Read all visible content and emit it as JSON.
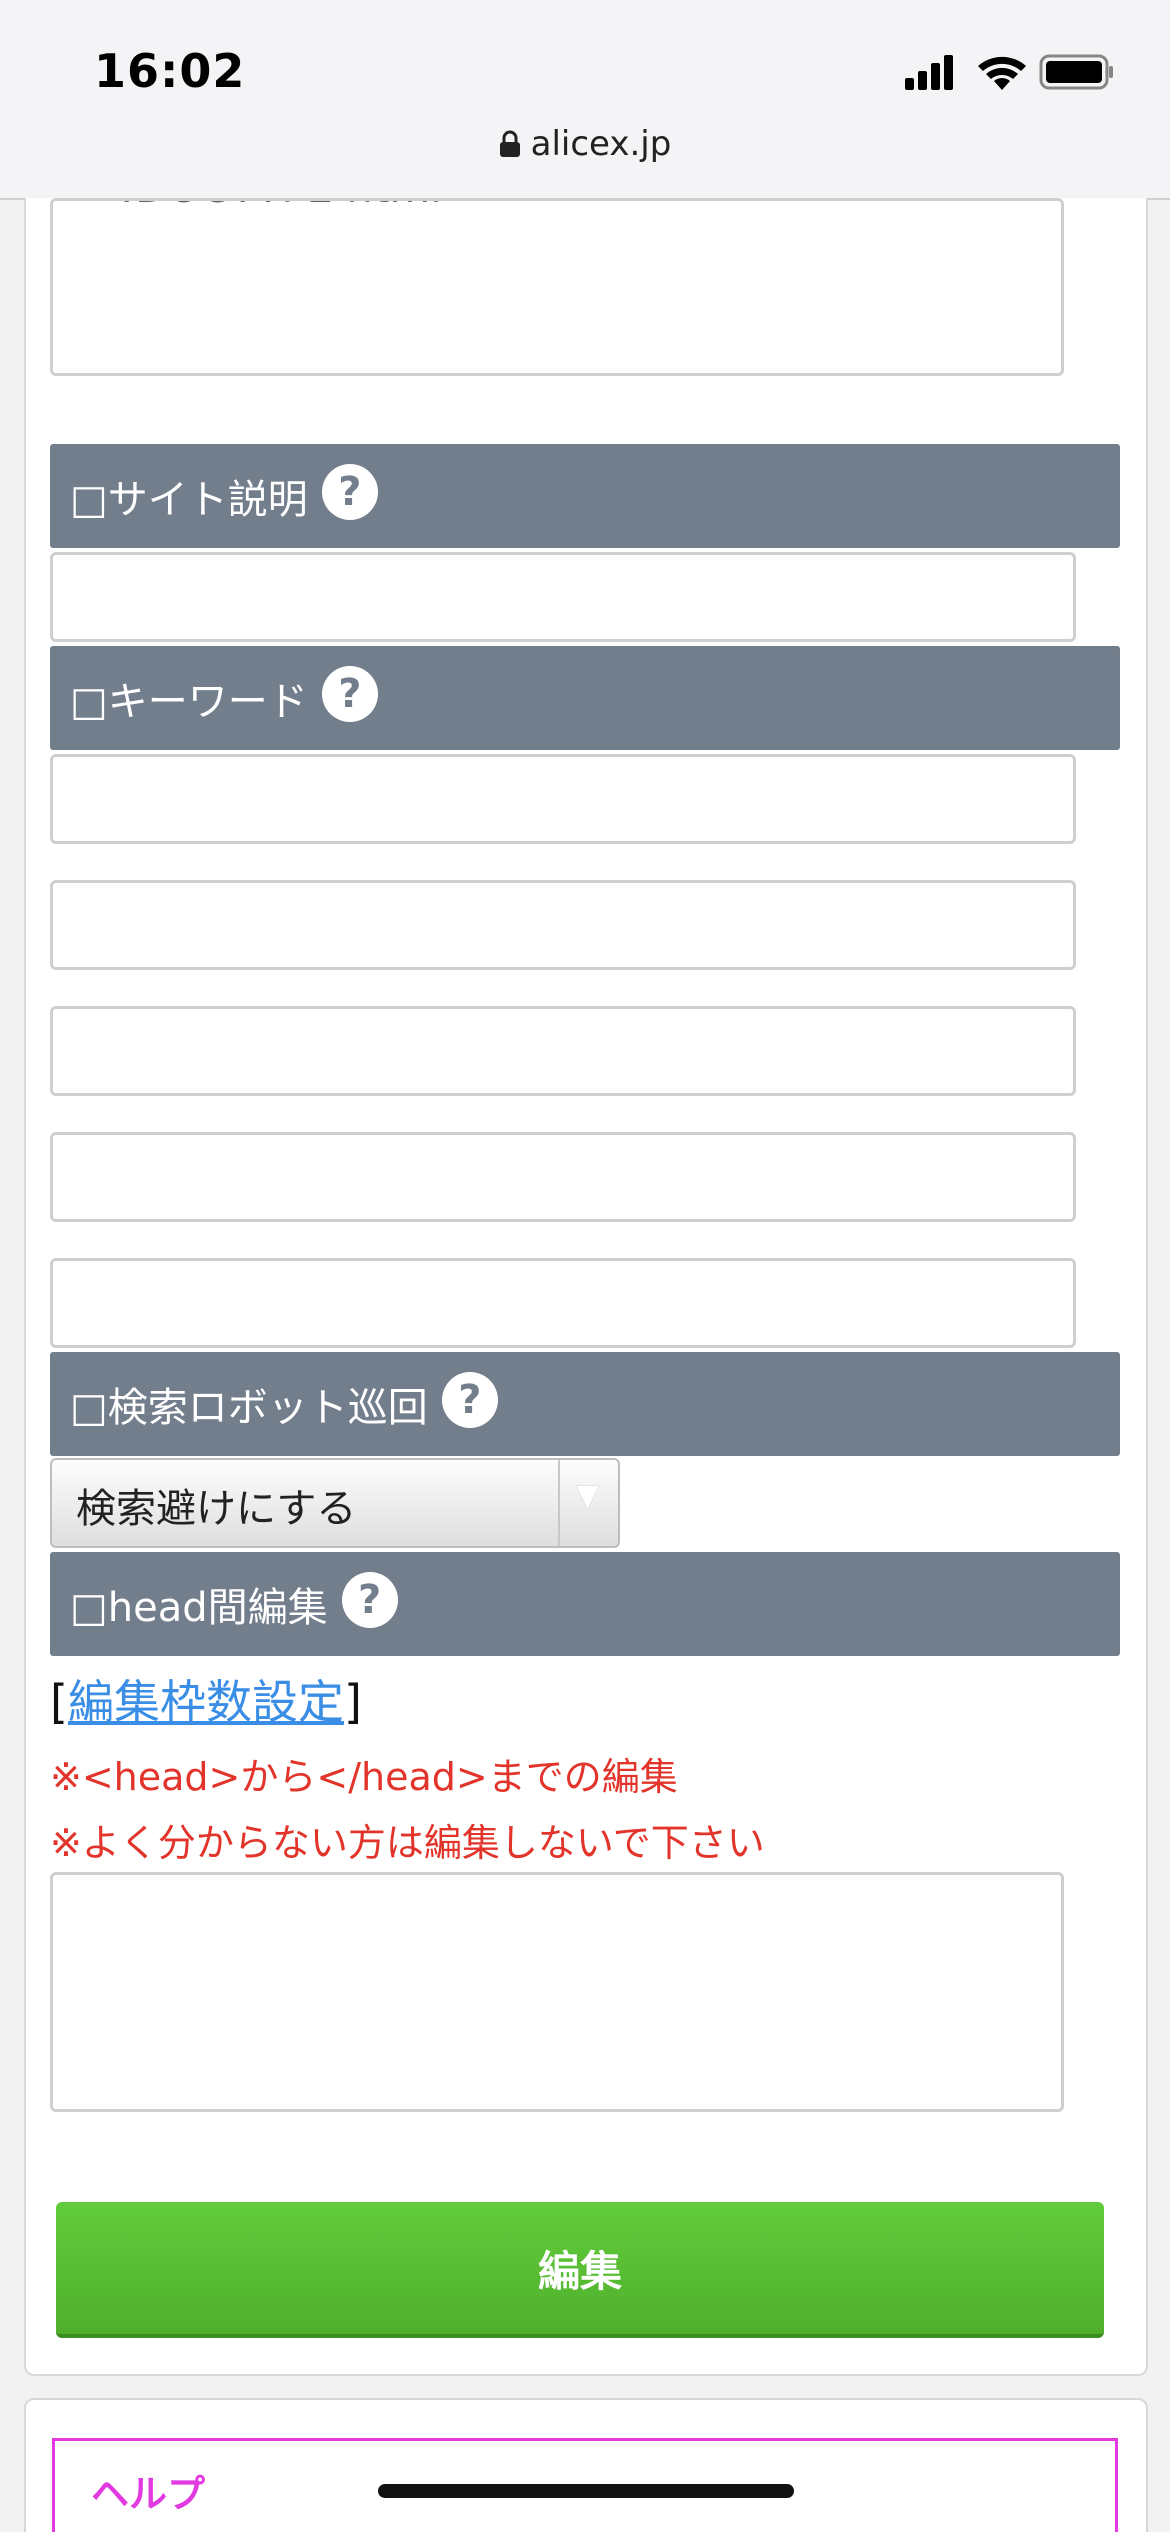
{
  "status_bar": {
    "time": "16:02",
    "url": "alicex.jp"
  },
  "form": {
    "top_textarea_value": "<!DOCTYPE html>",
    "sections": {
      "site_description": {
        "label": "□サイト説明",
        "help": "?"
      },
      "keywords": {
        "label": "□キーワード",
        "help": "?"
      },
      "robots": {
        "label": "□検索ロボット巡回",
        "help": "?"
      },
      "head_edit": {
        "label": "□head間編集",
        "help": "?"
      }
    },
    "robots_select": {
      "selected": "検索避けにする",
      "arrow": "▼"
    },
    "edit_frame_link": {
      "open_bracket": "[",
      "label": "編集枠数設定",
      "close_bracket": "]"
    },
    "notes": [
      "※<head>から</head>までの編集",
      "※よく分からない方は編集しないで下さい"
    ],
    "submit_label": "編集"
  },
  "help_section": {
    "title": "ヘルプ"
  },
  "colors": {
    "section_header_bg": "#737e8c",
    "link": "#3a8ee6",
    "note_text": "#e2342a",
    "submit_green": "#5bbf35",
    "help_magenta": "#e23ae0"
  }
}
